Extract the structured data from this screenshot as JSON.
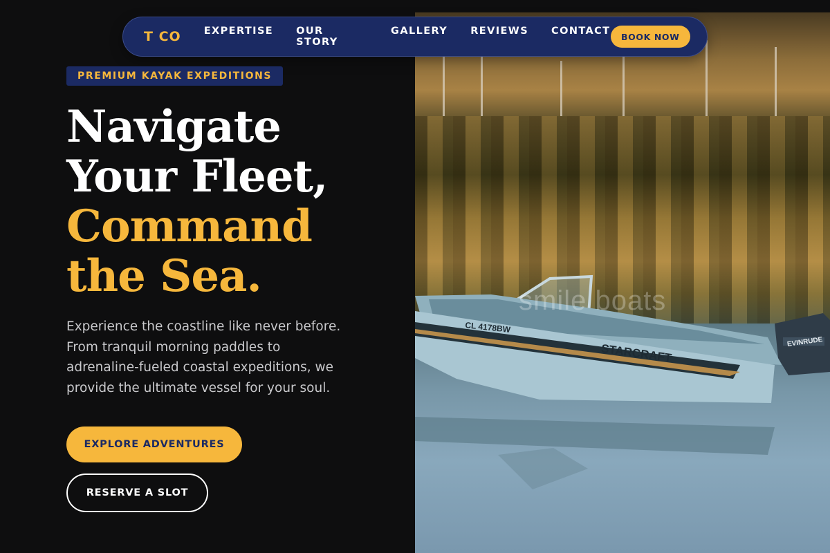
{
  "nav": {
    "logo": "T CO",
    "links": [
      "EXPERTISE",
      "OUR STORY",
      "GALLERY",
      "REVIEWS",
      "CONTACT"
    ],
    "cta": "BOOK NOW"
  },
  "hero": {
    "badge": "PREMIUM KAYAK EXPEDITIONS",
    "headline_line1": "Navigate",
    "headline_line2": "Your Fleet,",
    "headline_line3": "Command",
    "headline_line4": "the Sea.",
    "description": "Experience the coastline like never before. From tranquil morning paddles to adrenaline-fueled coastal expeditions, we provide the ultimate vessel for your soul.",
    "primary_button": "EXPLORE ADVENTURES",
    "secondary_button": "RESERVE A SLOT"
  },
  "photo": {
    "boat_brand": "STARCRAFT",
    "boat_registration": "CL 4178BW",
    "motor_brand": "EVINRUDE",
    "watermark": "smile boats"
  },
  "colors": {
    "accent": "#f6b73c",
    "navy": "#1b2a63",
    "background": "#0e0e0f"
  }
}
